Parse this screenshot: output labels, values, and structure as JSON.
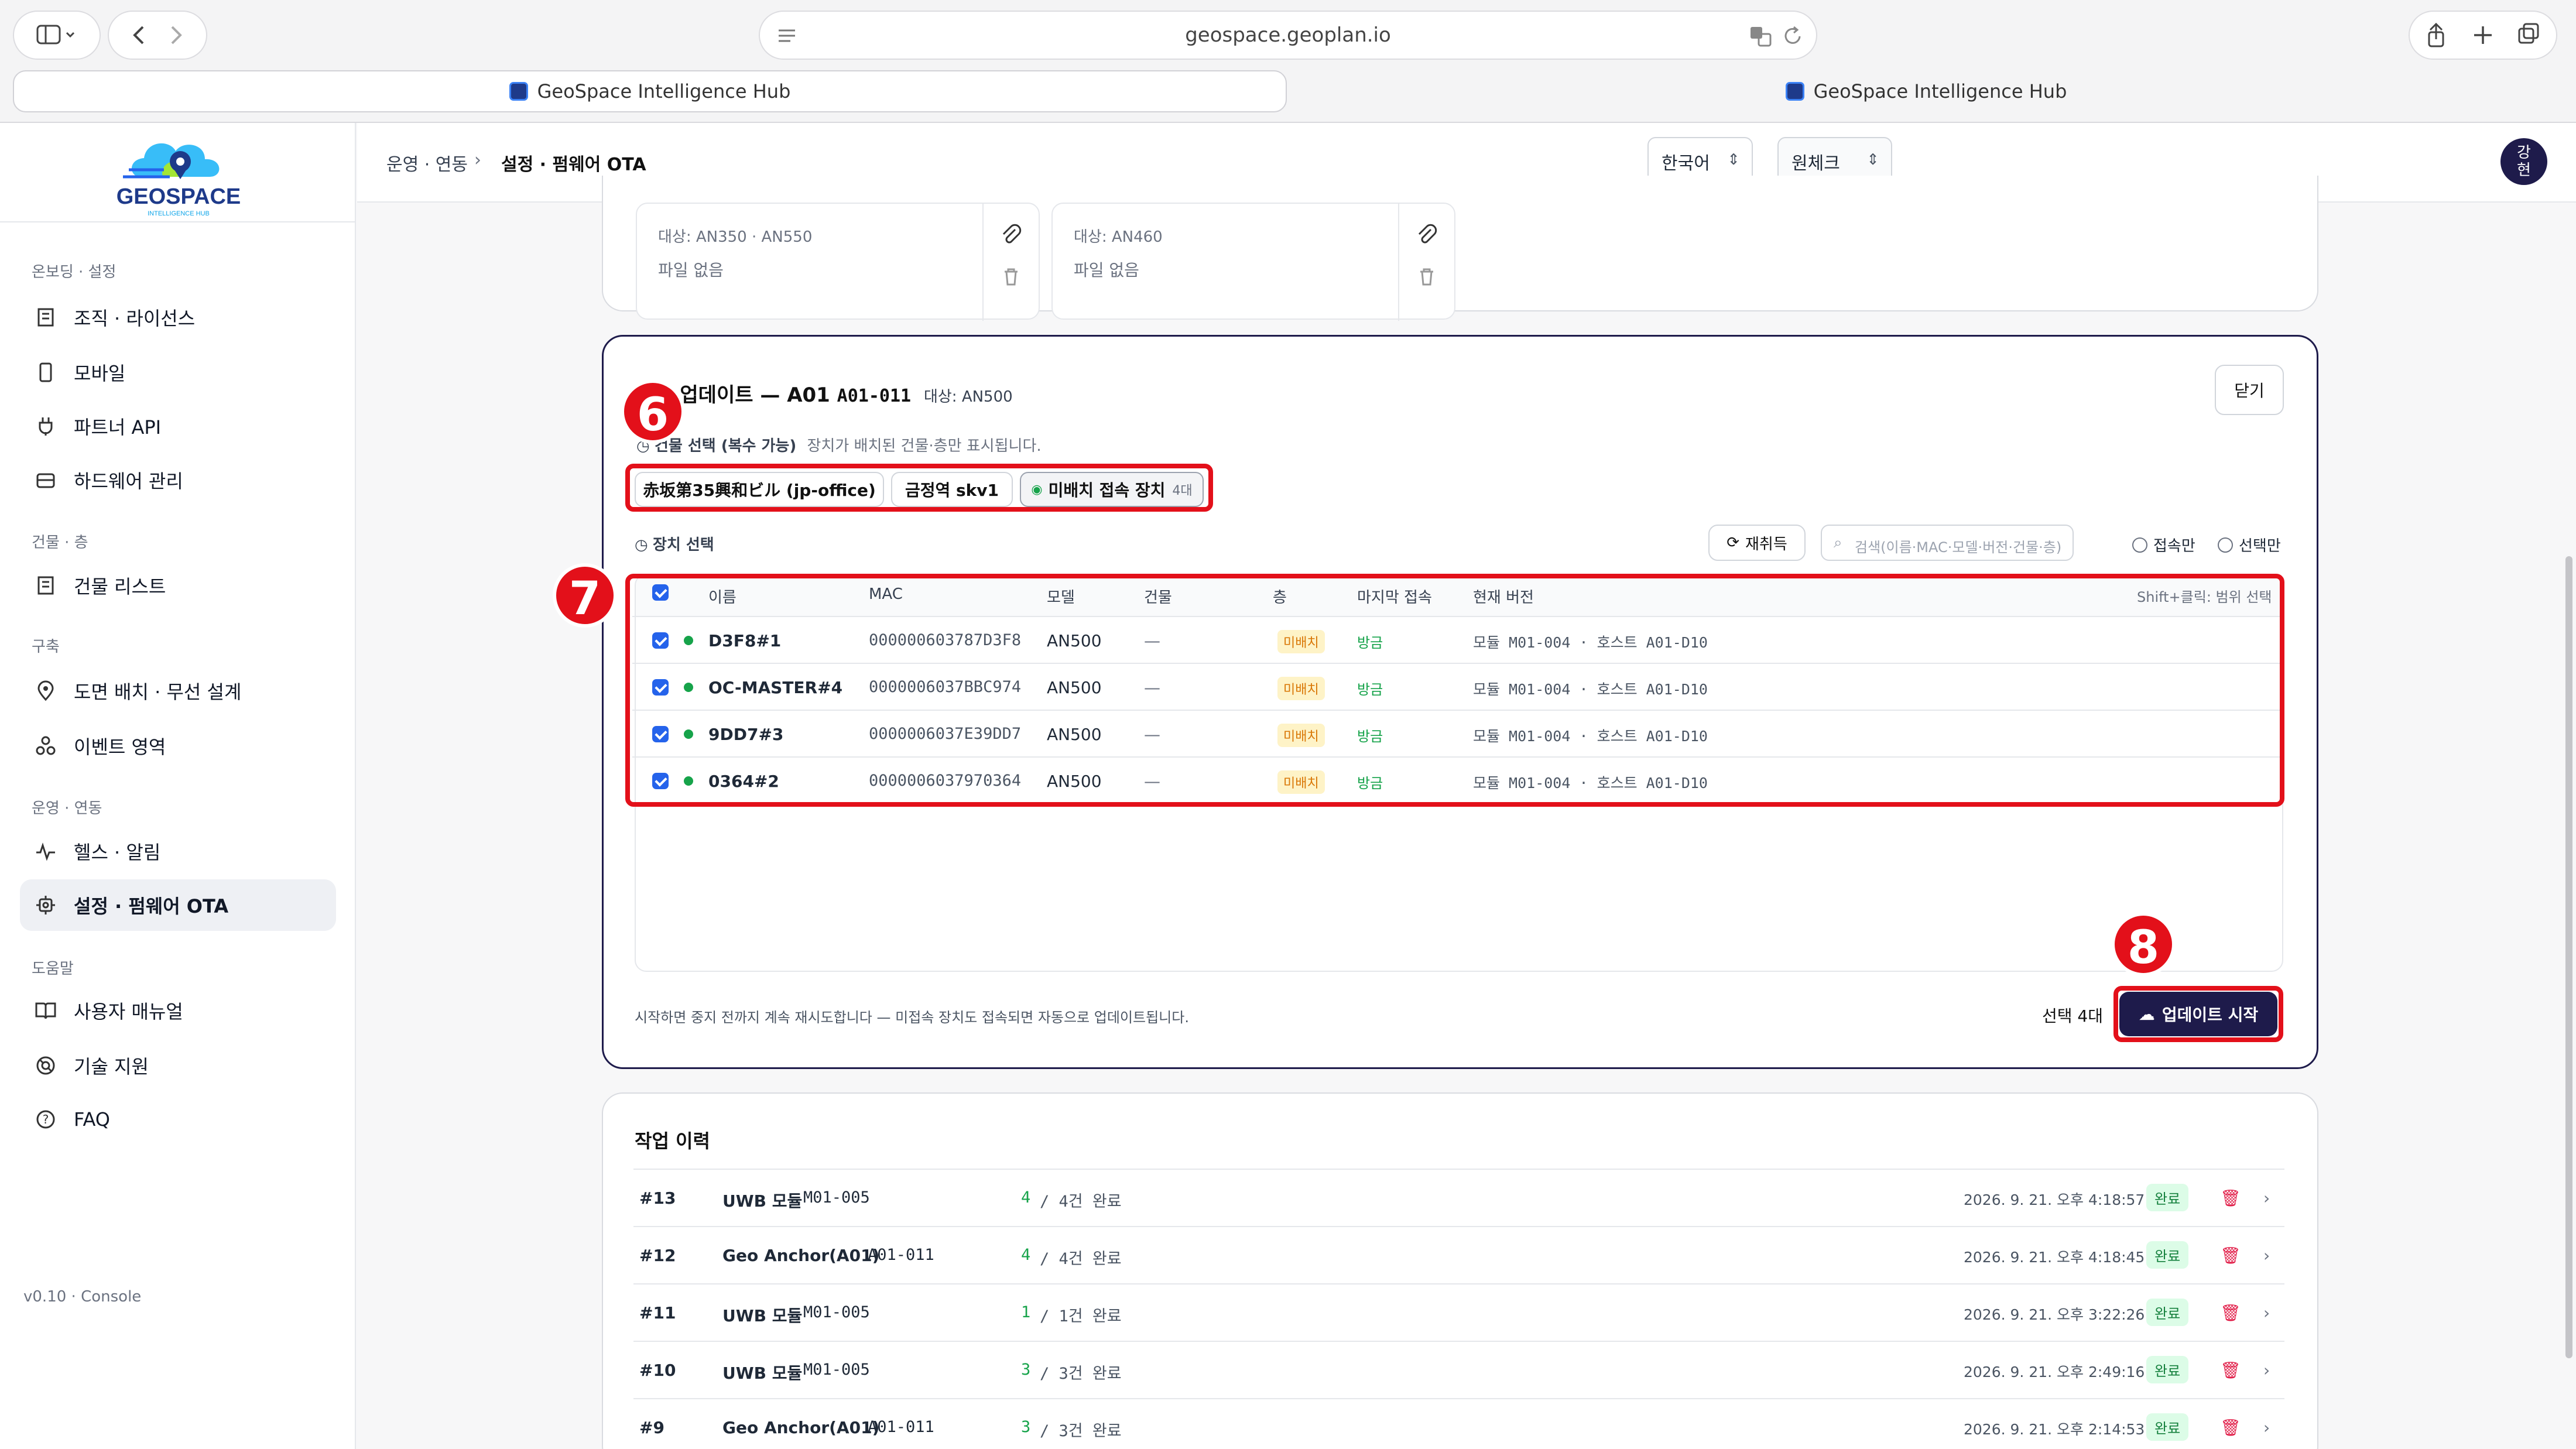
{
  "browser": {
    "url": "geospace.geoplan.io",
    "tabs": [
      "GeoSpace Intelligence Hub",
      "GeoSpace Intelligence Hub"
    ]
  },
  "sidebar": {
    "logo_text": "GEOSPACE",
    "logo_sub": "INTELLIGENCE HUB",
    "sections": [
      {
        "title": "온보딩 · 설정",
        "items": [
          {
            "label": "조직 · 라이선스",
            "icon": "building-icon"
          },
          {
            "label": "모바일",
            "icon": "mobile-icon"
          },
          {
            "label": "파트너 API",
            "icon": "plug-icon"
          },
          {
            "label": "하드웨어 관리",
            "icon": "hardware-icon"
          }
        ]
      },
      {
        "title": "건물 · 층",
        "items": [
          {
            "label": "건물 리스트",
            "icon": "building-list-icon"
          }
        ]
      },
      {
        "title": "구축",
        "items": [
          {
            "label": "도면 배치 · 무선 설계",
            "icon": "pin-icon"
          },
          {
            "label": "이벤트 영역",
            "icon": "zones-icon"
          }
        ]
      },
      {
        "title": "운영 · 연동",
        "items": [
          {
            "label": "헬스 · 알림",
            "icon": "pulse-icon"
          },
          {
            "label": "설정 · 펌웨어 OTA",
            "icon": "chip-icon",
            "active": true
          }
        ]
      },
      {
        "title": "도움말",
        "items": [
          {
            "label": "사용자 매뉴얼",
            "icon": "book-icon"
          },
          {
            "label": "기술 지원",
            "icon": "lifebuoy-icon"
          },
          {
            "label": "FAQ",
            "icon": "help-icon"
          }
        ]
      }
    ],
    "version": "v0.10 · Console"
  },
  "header": {
    "breadcrumb_parent": "운영 · 연동",
    "breadcrumb_sep": "›",
    "breadcrumb_current": "설정 · 펌웨어 OTA",
    "language": "한국어",
    "org": "원체크",
    "avatar": "강\n현"
  },
  "files": [
    {
      "target": "대상: AN350 · AN550",
      "file": "파일  없음"
    },
    {
      "target": "대상: AN460",
      "file": "파일  없음"
    }
  ],
  "update_panel": {
    "title_prefix": "일괄 업데이트 — A01",
    "title_code": "A01-011",
    "title_target": "대상: AN500",
    "close": "닫기",
    "building_label": "건물 선택 (복수 가능)",
    "building_hint": "장치가 배치된 건물·층만 표시됩니다.",
    "chips": [
      "赤坂第35興和ビル (jp-office)",
      "금정역 skv1",
      "미배치 접속 장치"
    ],
    "chip_count": "4대",
    "device_label": "장치 선택",
    "refresh": "재취득",
    "search_placeholder": "검색(이름·MAC·모델·버전·건물·층)",
    "filter_connected": "접속만",
    "filter_selected": "선택만",
    "columns": [
      "이름",
      "MAC",
      "모델",
      "건물",
      "층",
      "마지막 접속",
      "현재 버전"
    ],
    "range_hint": "Shift+클릭: 범위 선택",
    "rows": [
      {
        "name": "D3F8#1",
        "mac": "000000603787D3F8",
        "model": "AN500",
        "building": "—",
        "floor": "미배치",
        "last": "방금",
        "version": "모듈 M01-004 · 호스트 A01-D10"
      },
      {
        "name": "OC-MASTER#4",
        "mac": "0000006037BBC974",
        "model": "AN500",
        "building": "—",
        "floor": "미배치",
        "last": "방금",
        "version": "모듈 M01-004 · 호스트 A01-D10"
      },
      {
        "name": "9DD7#3",
        "mac": "0000006037E39DD7",
        "model": "AN500",
        "building": "—",
        "floor": "미배치",
        "last": "방금",
        "version": "모듈 M01-004 · 호스트 A01-D10"
      },
      {
        "name": "0364#2",
        "mac": "0000006037970364",
        "model": "AN500",
        "building": "—",
        "floor": "미배치",
        "last": "방금",
        "version": "모듈 M01-004 · 호스트 A01-D10"
      }
    ],
    "footer_note": "시작하면 중지 전까지 계속 재시도합니다 — 미접속 장치도 접속되면 자동으로 업데이트됩니다.",
    "selected_count": "선택 4대",
    "start": "업데이트 시작"
  },
  "history": {
    "title": "작업 이력",
    "rows": [
      {
        "id": "#13",
        "type": "UWB 모듈",
        "ver": "M01-005",
        "done": "4",
        "total": "/  4건 완료",
        "time": "2026. 9. 21. 오후 4:18:57",
        "status": "완료"
      },
      {
        "id": "#12",
        "type": "Geo Anchor(A01)",
        "ver": "A01-011",
        "done": "4",
        "total": "/  4건 완료",
        "time": "2026. 9. 21. 오후 4:18:45",
        "status": "완료"
      },
      {
        "id": "#11",
        "type": "UWB 모듈",
        "ver": "M01-005",
        "done": "1",
        "total": "/  1건 완료",
        "time": "2026. 9. 21. 오후 3:22:26",
        "status": "완료"
      },
      {
        "id": "#10",
        "type": "UWB 모듈",
        "ver": "M01-005",
        "done": "3",
        "total": "/  3건 완료",
        "time": "2026. 9. 21. 오후 2:49:16",
        "status": "완료"
      },
      {
        "id": "#9",
        "type": "Geo Anchor(A01)",
        "ver": "A01-011",
        "done": "3",
        "total": "/  3건 완료",
        "time": "2026. 9. 21. 오후 2:14:53",
        "status": "완료"
      }
    ]
  },
  "markers": [
    "6",
    "7",
    "8"
  ],
  "colors": {
    "accent": "#1e1b4b",
    "annotation": "#e3101a",
    "ok": "#16a34a",
    "warn": "#d97706"
  }
}
